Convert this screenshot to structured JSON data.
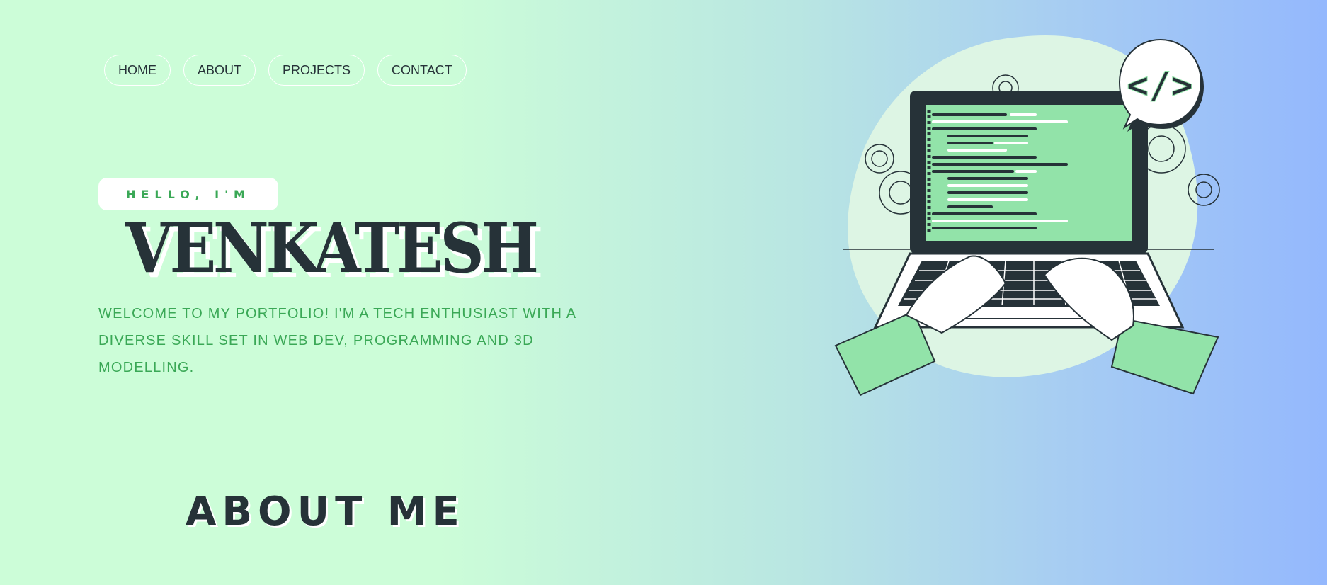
{
  "nav": {
    "items": [
      {
        "label": "HOME"
      },
      {
        "label": "ABOUT"
      },
      {
        "label": "PROJECTS"
      },
      {
        "label": "CONTACT"
      }
    ]
  },
  "hero": {
    "greeting": "HELLO, I'M",
    "name": "VENKATESH",
    "intro": "WELCOME TO MY PORTFOLIO! I'M A TECH ENTHUSIAST WITH A DIVERSE SKILL SET IN WEB DEV, PROGRAMMING AND 3D MODELLING."
  },
  "illustration": {
    "code_badge": "</>"
  },
  "about": {
    "title": "ABOUT ME"
  },
  "colors": {
    "accent_green": "#3aa856",
    "dark": "#263238",
    "screen_green": "#92e3a9",
    "gradient_start": "#ccfdd8",
    "gradient_end": "#94b8fd"
  }
}
